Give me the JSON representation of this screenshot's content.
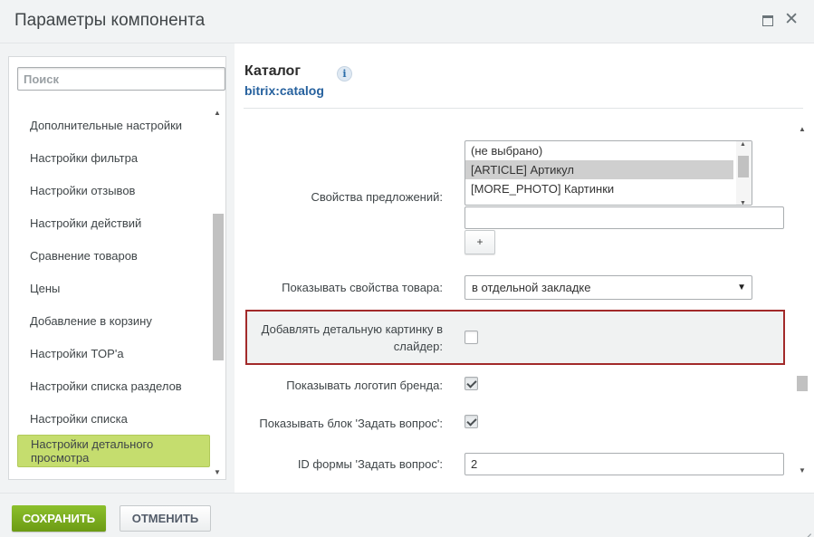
{
  "window": {
    "title": "Параметры компонента"
  },
  "search": {
    "placeholder": "Поиск"
  },
  "sidebar": {
    "items": [
      {
        "label": "Дополнительные настройки"
      },
      {
        "label": "Настройки фильтра"
      },
      {
        "label": "Настройки отзывов"
      },
      {
        "label": "Настройки действий"
      },
      {
        "label": "Сравнение товаров"
      },
      {
        "label": "Цены"
      },
      {
        "label": "Добавление в корзину"
      },
      {
        "label": "Настройки TOP'а"
      },
      {
        "label": "Настройки списка разделов"
      },
      {
        "label": "Настройки списка"
      },
      {
        "label": "Настройки детального просмотра",
        "active": true
      }
    ]
  },
  "component": {
    "title": "Каталог",
    "code": "bitrix:catalog",
    "info_icon": "i"
  },
  "form": {
    "offer_props": {
      "label": "Свойства предложений:",
      "options": [
        "(не выбрано)",
        "[ARTICLE] Артикул",
        "[MORE_PHOTO] Картинки"
      ],
      "selected": "[ARTICLE] Артикул",
      "text_value": "",
      "add_label": "+"
    },
    "show_props": {
      "label": "Показывать свойства товара:",
      "value": "в отдельной закладке"
    },
    "add_detail_pic": {
      "label": "Добавлять детальную картинку в слайдер:",
      "checked": false
    },
    "show_brand_logo": {
      "label": "Показывать логотип бренда:",
      "checked": true
    },
    "show_ask_block": {
      "label": "Показывать блок 'Задать вопрос':",
      "checked": true
    },
    "ask_form_id": {
      "label": "ID формы 'Задать вопрос':",
      "value": "2"
    }
  },
  "footer": {
    "save_label": "СОХРАНИТЬ",
    "cancel_label": "ОТМЕНИТЬ"
  },
  "colors": {
    "save_green": "#7aab1e",
    "active_item": "#c5dd6e",
    "highlight_border": "#a22a2a",
    "link_blue": "#26619e"
  }
}
